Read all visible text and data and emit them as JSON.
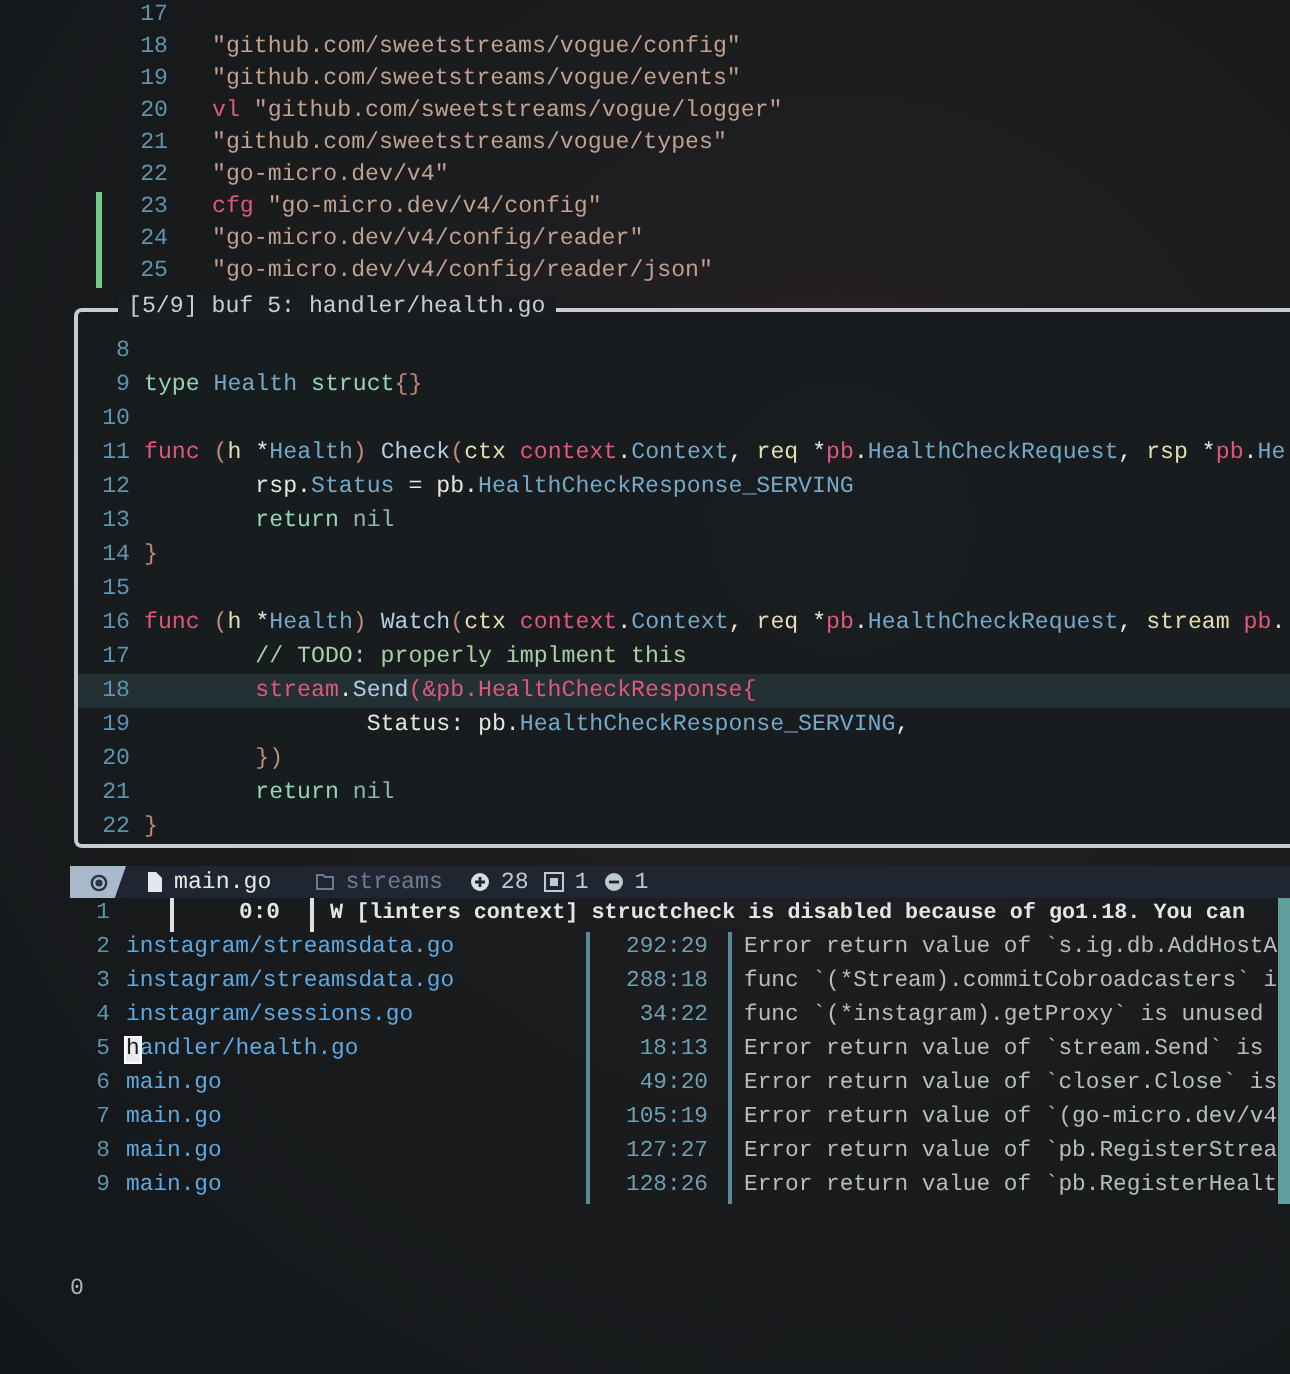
{
  "editor": {
    "lines": [
      {
        "number": "17",
        "changed": false
      },
      {
        "number": "18",
        "changed": false,
        "segments": [
          {
            "kind": "str",
            "text": "\"github.com/sweetstreams/vogue/config\""
          }
        ]
      },
      {
        "number": "19",
        "changed": false,
        "segments": [
          {
            "kind": "str",
            "text": "\"github.com/sweetstreams/vogue/events\""
          }
        ]
      },
      {
        "number": "20",
        "changed": false,
        "segments": [
          {
            "kind": "kw",
            "text": "vl"
          },
          {
            "kind": "str",
            "text": " \"github.com/sweetstreams/vogue/logger\""
          }
        ]
      },
      {
        "number": "21",
        "changed": false,
        "segments": [
          {
            "kind": "str",
            "text": "\"github.com/sweetstreams/vogue/types\""
          }
        ]
      },
      {
        "number": "22",
        "changed": false,
        "segments": [
          {
            "kind": "str",
            "text": "\"go-micro.dev/v4\""
          }
        ]
      },
      {
        "number": "23",
        "changed": true,
        "segments": [
          {
            "kind": "kw",
            "text": "cfg"
          },
          {
            "kind": "str",
            "text": " \"go-micro.dev/v4/config\""
          }
        ]
      },
      {
        "number": "24",
        "changed": true,
        "segments": [
          {
            "kind": "str",
            "text": "\"go-micro.dev/v4/config/reader\""
          }
        ]
      },
      {
        "number": "25",
        "changed": true,
        "segments": [
          {
            "kind": "str",
            "text": "\"go-micro.dev/v4/config/reader/json\""
          }
        ]
      }
    ]
  },
  "float_window": {
    "title": "[5/9] buf 5: handler/health.go",
    "lines": [
      {
        "number": "8",
        "current": false
      },
      {
        "number": "9",
        "current": false,
        "segments": [
          {
            "kind": "tk",
            "text": "type"
          },
          {
            "kind": "ty",
            "text": " Health"
          },
          {
            "kind": "tk",
            "text": " struct"
          },
          {
            "kind": "punc",
            "text": "{}"
          }
        ]
      },
      {
        "number": "10",
        "current": false
      },
      {
        "number": "11",
        "current": false,
        "segments": [
          {
            "kind": "kw",
            "text": "func"
          },
          {
            "kind": "punc",
            "text": " ("
          },
          {
            "kind": "param",
            "text": "h"
          },
          {
            "kind": "plain",
            "text": " *"
          },
          {
            "kind": "ty",
            "text": "Health"
          },
          {
            "kind": "punc",
            "text": ")"
          },
          {
            "kind": "fn",
            "text": " Check"
          },
          {
            "kind": "punc",
            "text": "("
          },
          {
            "kind": "param",
            "text": "ctx"
          },
          {
            "kind": "kw",
            "text": " context"
          },
          {
            "kind": "plain",
            "text": "."
          },
          {
            "kind": "ty",
            "text": "Context"
          },
          {
            "kind": "plain",
            "text": ", "
          },
          {
            "kind": "param",
            "text": "req"
          },
          {
            "kind": "plain",
            "text": " *"
          },
          {
            "kind": "kw",
            "text": "pb"
          },
          {
            "kind": "plain",
            "text": "."
          },
          {
            "kind": "ty",
            "text": "HealthCheckRequest"
          },
          {
            "kind": "plain",
            "text": ", "
          },
          {
            "kind": "param",
            "text": "rsp"
          },
          {
            "kind": "plain",
            "text": " *"
          },
          {
            "kind": "kw",
            "text": "pb"
          },
          {
            "kind": "plain",
            "text": "."
          },
          {
            "kind": "ty",
            "text": "He"
          }
        ]
      },
      {
        "number": "12",
        "current": false,
        "segments": [
          {
            "kind": "plain",
            "text": "\trsp."
          },
          {
            "kind": "ty",
            "text": "Status"
          },
          {
            "kind": "plain",
            "text": " = pb."
          },
          {
            "kind": "ty",
            "text": "HealthCheckResponse_SERVING"
          }
        ]
      },
      {
        "number": "13",
        "current": false,
        "segments": [
          {
            "kind": "tk",
            "text": "\treturn"
          },
          {
            "kind": "nil",
            "text": " nil"
          }
        ]
      },
      {
        "number": "14",
        "current": false,
        "segments": [
          {
            "kind": "punc",
            "text": "}"
          }
        ]
      },
      {
        "number": "15",
        "current": false
      },
      {
        "number": "16",
        "current": false,
        "segments": [
          {
            "kind": "kw",
            "text": "func"
          },
          {
            "kind": "punc",
            "text": " ("
          },
          {
            "kind": "param",
            "text": "h"
          },
          {
            "kind": "plain",
            "text": " *"
          },
          {
            "kind": "ty",
            "text": "Health"
          },
          {
            "kind": "punc",
            "text": ")"
          },
          {
            "kind": "fn",
            "text": " Watch"
          },
          {
            "kind": "punc",
            "text": "("
          },
          {
            "kind": "param",
            "text": "ctx"
          },
          {
            "kind": "kw",
            "text": " context"
          },
          {
            "kind": "plain",
            "text": "."
          },
          {
            "kind": "ty",
            "text": "Context"
          },
          {
            "kind": "plain",
            "text": ", "
          },
          {
            "kind": "param",
            "text": "req"
          },
          {
            "kind": "plain",
            "text": " *"
          },
          {
            "kind": "kw",
            "text": "pb"
          },
          {
            "kind": "plain",
            "text": "."
          },
          {
            "kind": "ty",
            "text": "HealthCheckRequest"
          },
          {
            "kind": "plain",
            "text": ", "
          },
          {
            "kind": "param",
            "text": "stream"
          },
          {
            "kind": "kw",
            "text": " pb"
          },
          {
            "kind": "plain",
            "text": "."
          }
        ]
      },
      {
        "number": "17",
        "current": false,
        "segments": [
          {
            "kind": "cm",
            "text": "\t// TODO: properly implment this"
          }
        ]
      },
      {
        "number": "18",
        "current": true,
        "segments": [
          {
            "kind": "kw",
            "text": "\tstream"
          },
          {
            "kind": "plain",
            "text": "."
          },
          {
            "kind": "fn",
            "text": "Send"
          },
          {
            "kind": "kw",
            "text": "(&pb.HealthCheckResponse{"
          }
        ]
      },
      {
        "number": "19",
        "current": false,
        "segments": [
          {
            "kind": "plain",
            "text": "\t\tStatus: pb."
          },
          {
            "kind": "ty",
            "text": "HealthCheckResponse_SERVING"
          },
          {
            "kind": "plain",
            "text": ","
          }
        ]
      },
      {
        "number": "20",
        "current": false,
        "segments": [
          {
            "kind": "punc",
            "text": "\t})"
          }
        ]
      },
      {
        "number": "21",
        "current": false,
        "segments": [
          {
            "kind": "tk",
            "text": "\treturn"
          },
          {
            "kind": "nil",
            "text": " nil"
          }
        ]
      },
      {
        "number": "22",
        "current": false,
        "segments": [
          {
            "kind": "punc",
            "text": "}"
          }
        ]
      }
    ]
  },
  "tabline": {
    "buffers": [
      {
        "label": "main.go",
        "selected": true
      }
    ],
    "directory": "streams",
    "diagnostics": [
      {
        "kind": "hint",
        "count": "28"
      },
      {
        "kind": "info",
        "count": "1"
      },
      {
        "kind": "warning",
        "count": "1"
      }
    ]
  },
  "quickfix": {
    "rows": [
      {
        "number": "1",
        "kind": "warning",
        "selected": false,
        "position": "0:0",
        "message": "W [linters context] structcheck is disabled because of go1.18. You can"
      },
      {
        "number": "2",
        "kind": "error",
        "selected": false,
        "file": "instagram/streamsdata.go",
        "position": "292:29",
        "message": "Error return value of `s.ig.db.AddHostA"
      },
      {
        "number": "3",
        "kind": "error",
        "selected": false,
        "file": "instagram/streamsdata.go",
        "position": "288:18",
        "message": "func `(*Stream).commitCobroadcasters` i"
      },
      {
        "number": "4",
        "kind": "error",
        "selected": false,
        "file": "instagram/sessions.go",
        "position": "34:22",
        "message": "func `(*instagram).getProxy` is unused"
      },
      {
        "number": "5",
        "kind": "error",
        "selected": true,
        "file": "handler/health.go",
        "position": "18:13",
        "message": "Error return value of `stream.Send` is"
      },
      {
        "number": "6",
        "kind": "error",
        "selected": false,
        "file": "main.go",
        "position": "49:20",
        "message": "Error return value of `closer.Close` is"
      },
      {
        "number": "7",
        "kind": "error",
        "selected": false,
        "file": "main.go",
        "position": "105:19",
        "message": "Error return value of `(go-micro.dev/v4"
      },
      {
        "number": "8",
        "kind": "error",
        "selected": false,
        "file": "main.go",
        "position": "127:27",
        "message": "Error return value of `pb.RegisterStrea"
      },
      {
        "number": "9",
        "kind": "error",
        "selected": false,
        "file": "main.go",
        "position": "128:26",
        "message": "Error return value of `pb.RegisterHealt"
      }
    ]
  },
  "command_line": {
    "text": "0"
  }
}
